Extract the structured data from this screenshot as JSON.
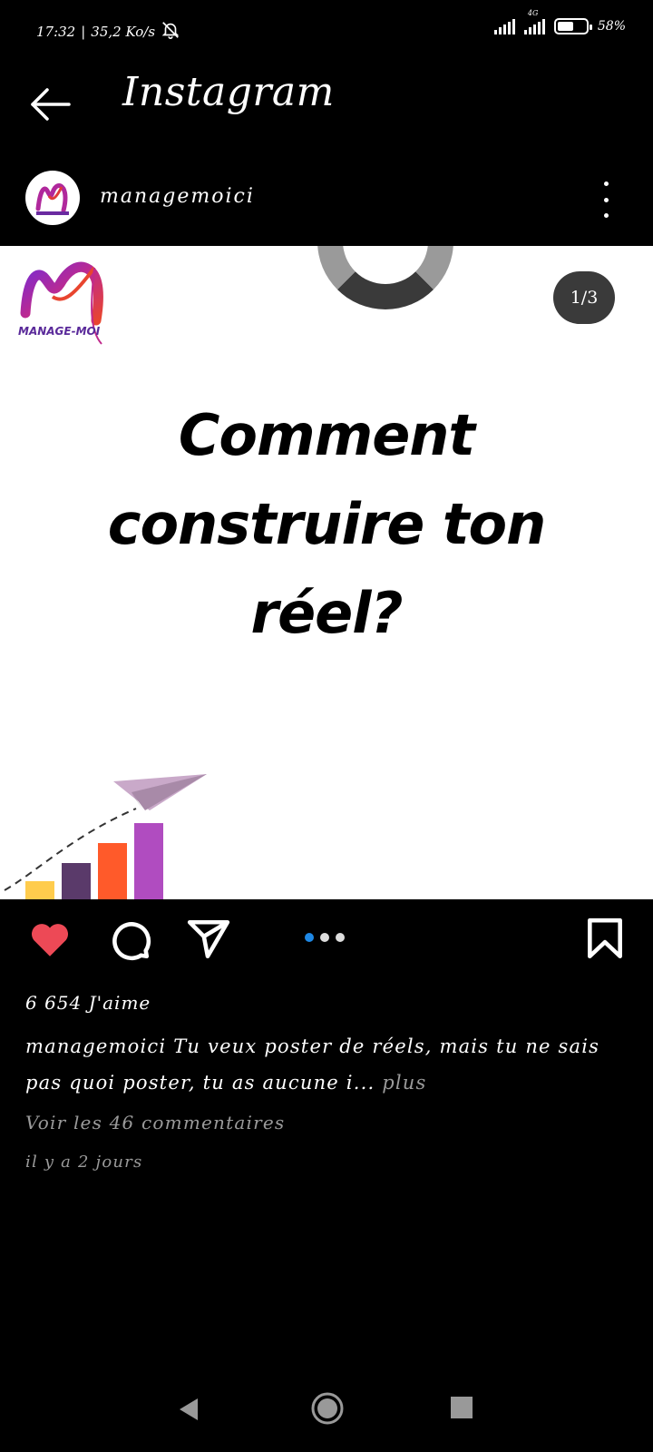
{
  "status_bar": {
    "time": "17:32",
    "separator": "|",
    "network_speed": "35,2 Ko/s",
    "network_type": "4G",
    "battery_level": "58%",
    "battery_fraction": 0.58
  },
  "header": {
    "app_title": "Instagram"
  },
  "post": {
    "username": "managemoici",
    "page_counter": "1/3",
    "headline_lines": [
      "Comment",
      "construire ton",
      "réel?"
    ],
    "logo_text": "MANAGE-MOI",
    "likes": "6 654 J'aime",
    "caption_username": "managemoici",
    "caption_text": "Tu veux poster de réels, mais tu ne sais pas quoi poster, tu as aucune i...",
    "caption_more": "plus",
    "comments_link": "Voir les 46 commentaires",
    "timestamp": "il y a 2 jours",
    "carousel": {
      "count": 3,
      "active_index": 0
    }
  },
  "icons": {
    "back": "arrow-left-icon",
    "more": "more-vertical-icon",
    "like": "heart-icon",
    "comment": "comment-icon",
    "share": "send-icon",
    "save": "bookmark-icon",
    "nav_back": "triangle-back-icon",
    "nav_home": "circle-home-icon",
    "nav_recent": "square-recents-icon"
  },
  "colors": {
    "like_red": "#ed4956",
    "carousel_active": "#1e88e5",
    "background": "#000000"
  }
}
